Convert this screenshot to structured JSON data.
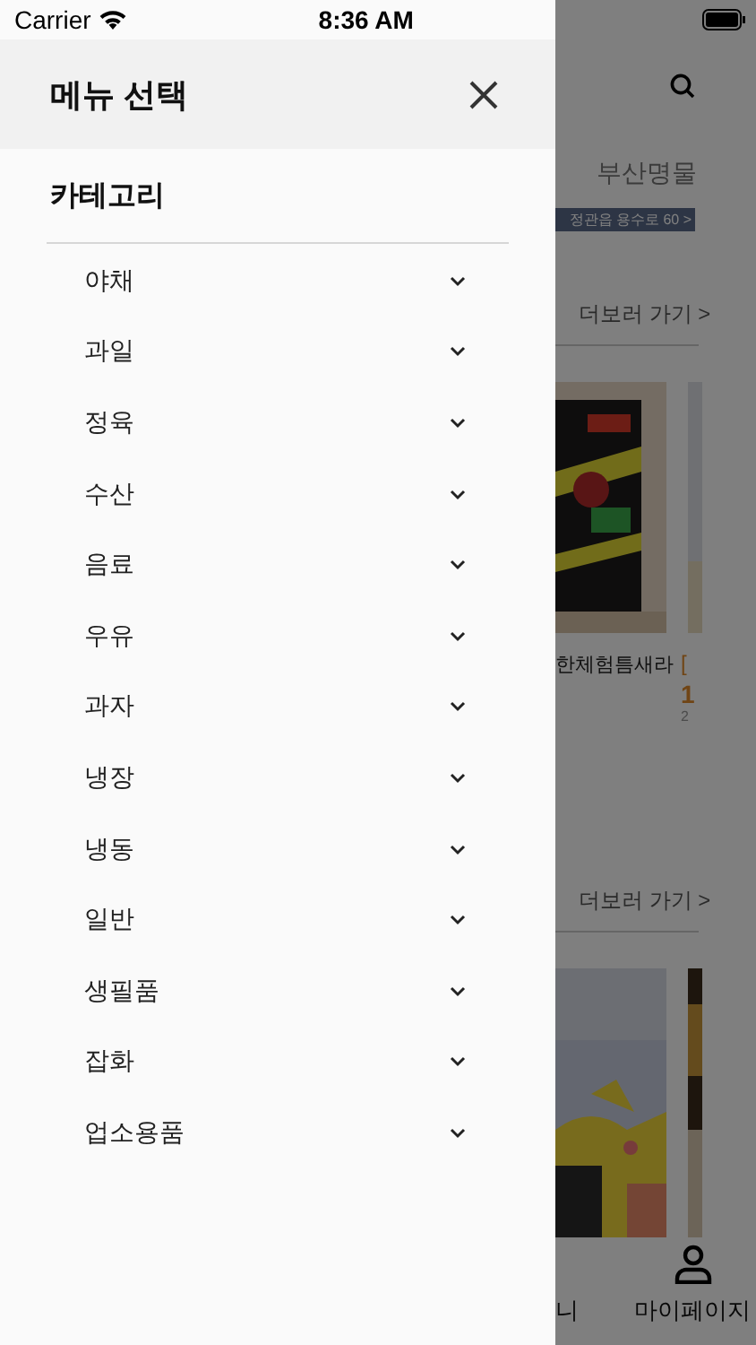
{
  "status_bar": {
    "carrier": "Carrier",
    "time": "8:36 AM"
  },
  "drawer": {
    "title": "메뉴 선택",
    "section": "카테고리",
    "items": [
      {
        "label": "야채",
        "expanded": false
      },
      {
        "label": "과일",
        "expanded": false
      },
      {
        "label": "정육",
        "expanded": false
      },
      {
        "label": "수산",
        "expanded": false
      },
      {
        "label": "음료",
        "expanded": false
      },
      {
        "label": "우유",
        "expanded": false
      },
      {
        "label": "과자",
        "expanded": false
      },
      {
        "label": "냉장",
        "expanded": false
      },
      {
        "label": "냉동",
        "expanded": false
      },
      {
        "label": "일반",
        "expanded": false
      },
      {
        "label": "생필품",
        "expanded": false
      },
      {
        "label": "잡화",
        "expanded": false
      },
      {
        "label": "업소용품",
        "expanded": false
      }
    ]
  },
  "background": {
    "tab": "부산명물",
    "banner": "정관읍 용수로 60 >",
    "more_links": [
      "더보러 가기 >",
      "더보러 가기 >"
    ],
    "product": {
      "title": "한체험틈새라"
    },
    "next_product": {
      "title": "[",
      "price": "1",
      "note": "2"
    },
    "bottom_tabs": [
      {
        "label": "니"
      },
      {
        "label": "마이페이지"
      }
    ]
  }
}
